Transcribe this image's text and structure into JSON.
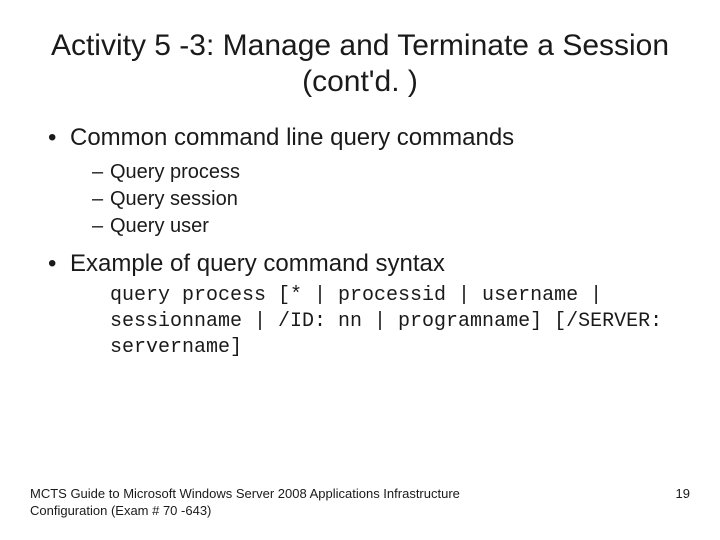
{
  "title": "Activity 5 -3: Manage and Terminate a Session (cont'd. )",
  "bullets": [
    {
      "text": "Common command line query commands",
      "sub": [
        "Query process",
        "Query session",
        "Query user"
      ]
    },
    {
      "text": "Example of query command syntax"
    }
  ],
  "code": "query process [* | processid | username | sessionname | /ID: nn | programname] [/SERVER: servername]",
  "footer_left": "MCTS Guide to Microsoft Windows Server 2008 Applications Infrastructure Configuration (Exam # 70 -643)",
  "footer_right": "19"
}
